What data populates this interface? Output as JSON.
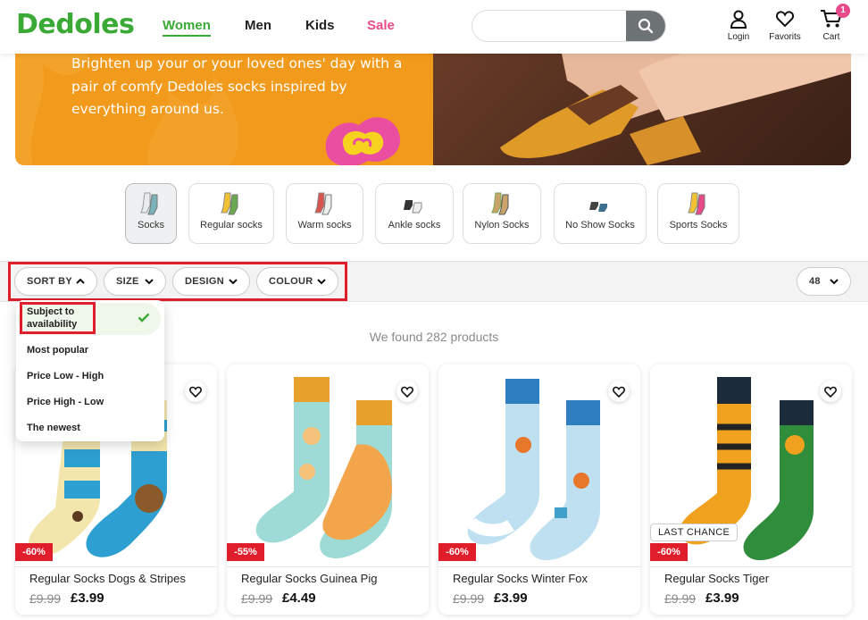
{
  "header": {
    "logo": "Dedoles",
    "nav": [
      "Women",
      "Men",
      "Kids",
      "Sale"
    ],
    "search": {
      "value": "",
      "placeholder": ""
    },
    "login_label": "Login",
    "favorites_label": "Favorits",
    "cart_label": "Cart",
    "cart_count": "1"
  },
  "banner": {
    "text": "Brighten up your or your loved ones' day with a pair of comfy Dedoles socks inspired by everything around us."
  },
  "categories": [
    {
      "label": "Socks",
      "icon": "socks-icon",
      "active": true
    },
    {
      "label": "Regular socks",
      "icon": "regular-socks-icon",
      "active": false
    },
    {
      "label": "Warm socks",
      "icon": "warm-socks-icon",
      "active": false
    },
    {
      "label": "Ankle socks",
      "icon": "ankle-socks-icon",
      "active": false
    },
    {
      "label": "Nylon Socks",
      "icon": "nylon-socks-icon",
      "active": false
    },
    {
      "label": "No Show Socks",
      "icon": "no-show-socks-icon",
      "active": false
    },
    {
      "label": "Sports Socks",
      "icon": "sports-socks-icon",
      "active": false
    }
  ],
  "filters": {
    "sort_label": "SORT BY",
    "size_label": "SIZE",
    "design_label": "DESIGN",
    "colour_label": "COLOUR",
    "per_page": "48"
  },
  "sort_options": [
    {
      "label": "Subject to availability",
      "selected": true
    },
    {
      "label": "Most popular",
      "selected": false
    },
    {
      "label": "Price Low - High",
      "selected": false
    },
    {
      "label": "Price High - Low",
      "selected": false
    },
    {
      "label": "The newest",
      "selected": false
    }
  ],
  "results_text": "We found 282 products",
  "products": [
    {
      "name": "Regular Socks Dogs & Stripes",
      "old_price": "£9.99",
      "price": "£3.99",
      "discount": "-60%",
      "badge": ""
    },
    {
      "name": "Regular Socks Guinea Pig",
      "old_price": "£9.99",
      "price": "£4.49",
      "discount": "-55%",
      "badge": ""
    },
    {
      "name": "Regular Socks Winter Fox",
      "old_price": "£9.99",
      "price": "£3.99",
      "discount": "-60%",
      "badge": ""
    },
    {
      "name": "Regular Socks Tiger",
      "old_price": "£9.99",
      "price": "£3.99",
      "discount": "-60%",
      "badge": "LAST CHANCE"
    }
  ],
  "colors": {
    "brand_green": "#3aa935",
    "sale_pink": "#e94b8a",
    "banner_orange": "#f29a1b",
    "discount_red": "#e01e2b",
    "highlight_red": "#e01e2b"
  }
}
